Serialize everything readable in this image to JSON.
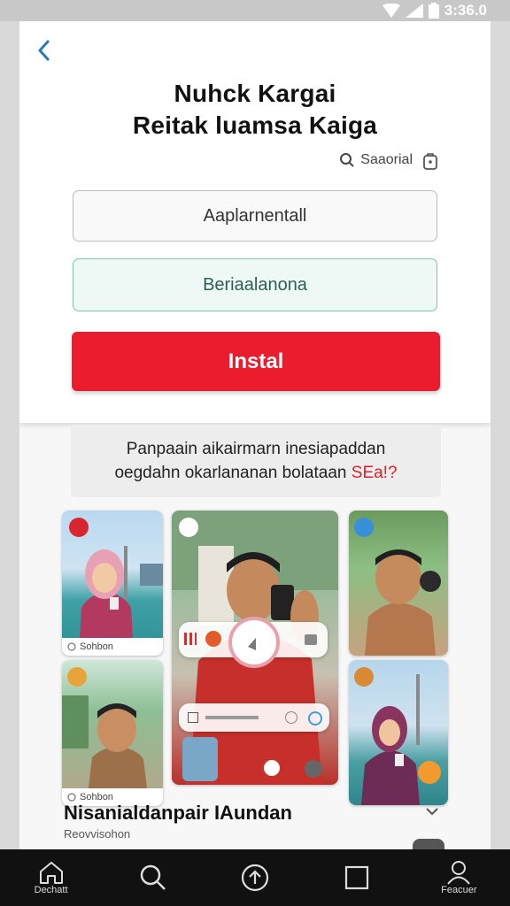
{
  "status_bar": {
    "time": "3:36.0"
  },
  "header": {
    "title_line1": "Nuhck Kargai",
    "title_line2": "Reitak luamsa Kaiga",
    "search_link": "Saaorial"
  },
  "form": {
    "field1_value": "Aaplarnentall",
    "field2_value": "Beriaalanona",
    "install_label": "Instal"
  },
  "notice": {
    "line1": "Panpaain aikairmarn inesiapaddan",
    "line2_main": "oegdahn okarlananan bolataan ",
    "line2_red": "SEa!?"
  },
  "gallery": {
    "caption1": "Sohbon",
    "caption2": "Sohbon"
  },
  "section": {
    "title": "Nisanialdanpair IAundan",
    "subtitle": "Reovvisohon"
  },
  "bottom_nav": {
    "items": [
      {
        "label": "Dechatt",
        "icon": "home-icon"
      },
      {
        "label": "",
        "icon": "search-icon"
      },
      {
        "label": "",
        "icon": "upload-icon"
      },
      {
        "label": "",
        "icon": "square-icon"
      },
      {
        "label": "Feacuer",
        "icon": "profile-icon"
      }
    ]
  },
  "colors": {
    "accent_red": "#ea1c2d",
    "field_green": "#7cc4ae"
  }
}
